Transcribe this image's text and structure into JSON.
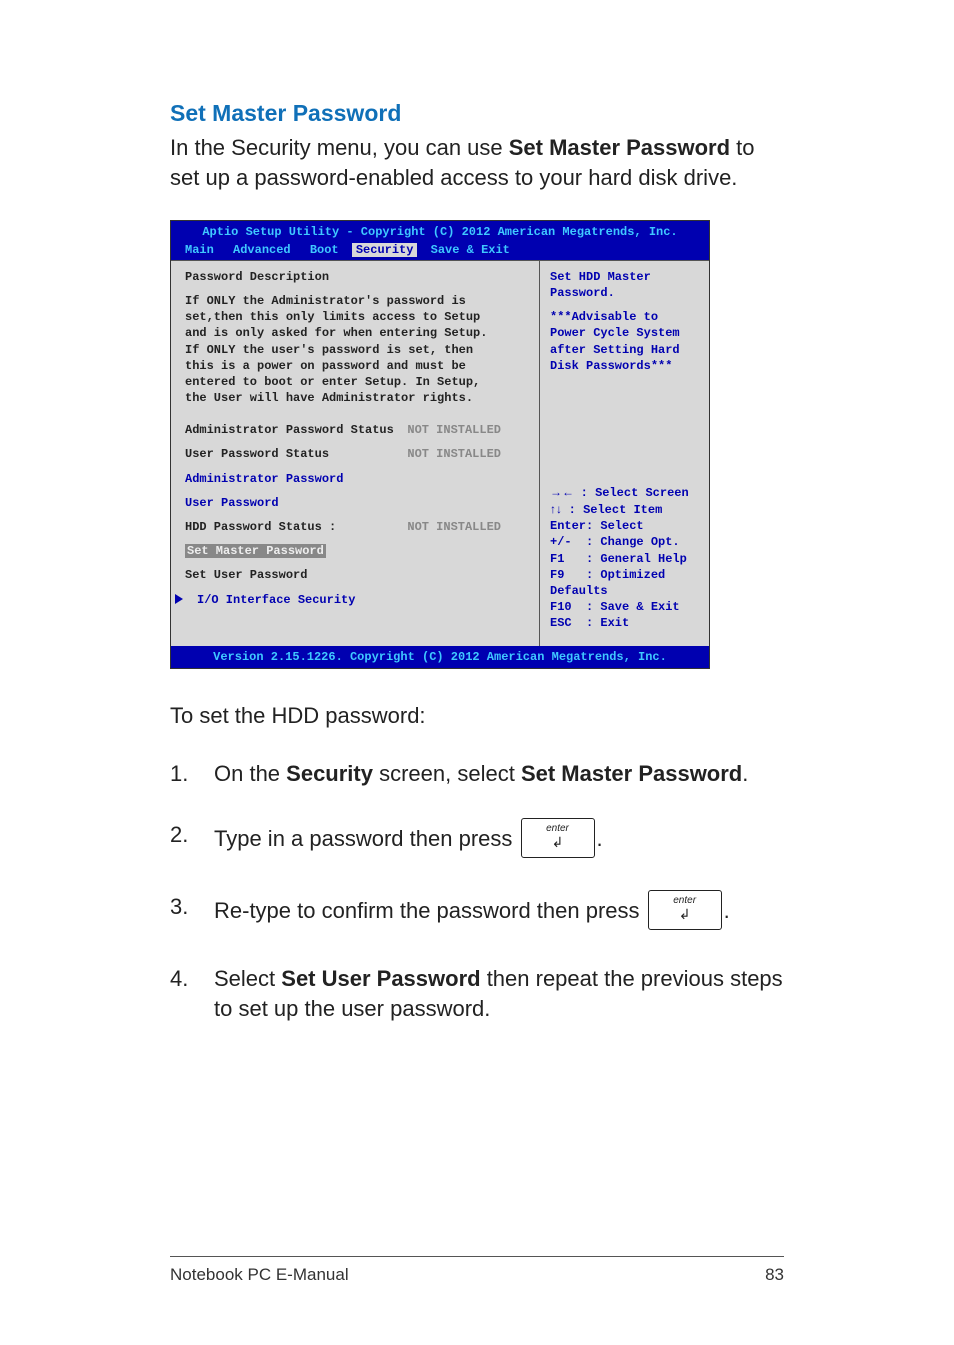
{
  "heading": "Set Master Password",
  "intro_pre": "In the Security menu, you can use ",
  "intro_bold": "Set Master Password",
  "intro_post": " to set up a password-enabled access to your hard disk drive.",
  "bios": {
    "title": "Aptio Setup Utility - Copyright (C) 2012 American Megatrends, Inc.",
    "tabs": {
      "a": "Main",
      "b": "Advanced",
      "c": "Boot",
      "d": "Security",
      "e": "Save & Exit"
    },
    "left": {
      "h": "Password Description",
      "d1": "If ONLY the Administrator's password is",
      "d2": "set,then this only limits access to Setup",
      "d3": "and is only asked for when entering Setup.",
      "d4": "If ONLY the user's password is set, then",
      "d5": "this is a power on password and must be",
      "d6": "entered to boot or enter Setup. In Setup,",
      "d7": "the User will have Administrator rights.",
      "aps_l": "Administrator Password Status",
      "aps_v": "NOT INSTALLED",
      "ups_l": "User Password Status",
      "ups_v": "NOT INSTALLED",
      "ap": "Administrator Password",
      "up": "User Password",
      "hdd_l": "HDD Password Status :",
      "hdd_v": "NOT INSTALLED",
      "smp": "Set Master Password",
      "sup": "Set User Password",
      "io": "I/O Interface Security"
    },
    "right": {
      "r1": "Set HDD Master",
      "r2": "Password.",
      "r3": "***Advisable to",
      "r4": "Power Cycle System",
      "r5": "after Setting Hard",
      "r6": "Disk Passwords***",
      "k1a": "→←  ",
      "k1b": ": Select Screen",
      "k2a": "↑↓  ",
      "k2b": ": Select Item",
      "k3": "Enter: Select",
      "k4": "+/-  : Change Opt.",
      "k5": "F1   : General Help",
      "k6": "F9   : Optimized",
      "k7": "Defaults",
      "k8": "F10  : Save & Exit",
      "k9": "ESC  : Exit"
    },
    "footer": "Version 2.15.1226. Copyright (C) 2012 American Megatrends, Inc."
  },
  "after_bios": "To set the HDD password:",
  "steps": {
    "n1": "1.",
    "s1a": "On the ",
    "s1b": "Security",
    "s1c": " screen, select ",
    "s1d": "Set Master Password",
    "s1e": ".",
    "n2": "2.",
    "s2a": "Type in a password then press ",
    "s2b": ".",
    "n3": "3.",
    "s3a": "Re-type to confirm the password then press ",
    "s3b": ".",
    "n4": "4.",
    "s4a": "Select ",
    "s4b": "Set User Password",
    "s4c": " then repeat the previous steps to set up the user password."
  },
  "key_label": "enter",
  "key_arrow": "↲",
  "footer_left": "Notebook PC E-Manual",
  "footer_right": "83"
}
